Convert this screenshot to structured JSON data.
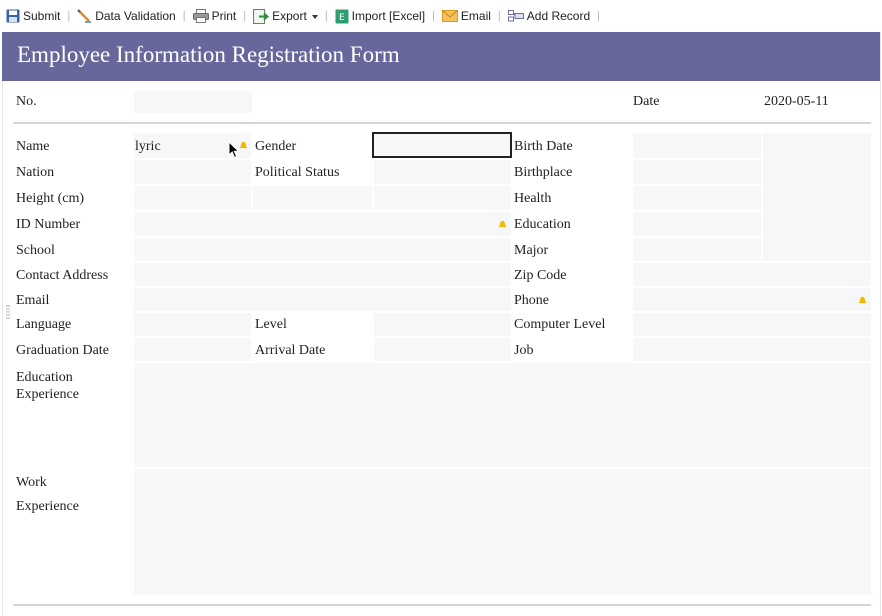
{
  "toolbar": {
    "items": [
      {
        "label": "Submit",
        "icon": "save-icon"
      },
      {
        "label": "Data Validation",
        "icon": "pencil-icon"
      },
      {
        "label": "Print",
        "icon": "printer-icon"
      },
      {
        "label": "Export",
        "icon": "export-icon"
      },
      {
        "label": "Import [Excel]",
        "icon": "excel-icon"
      },
      {
        "label": "Email",
        "icon": "envelope-icon"
      },
      {
        "label": "Add Record",
        "icon": "add-record-icon"
      }
    ]
  },
  "form": {
    "title": "Employee Information Registration Form",
    "header_color": "#67679c",
    "no_label": "No.",
    "date_label": "Date",
    "date_value": "2020-05-11",
    "labels": {
      "name": "Name",
      "gender": "Gender",
      "birth_date": "Birth Date",
      "nation": "Nation",
      "political_status": "Political Status",
      "birthplace": "Birthplace",
      "height": "Height (cm)",
      "health": "Health",
      "id_number": "ID Number",
      "education": "Education",
      "school": "School",
      "major": "Major",
      "contact_address": "Contact Address",
      "zip_code": "Zip Code",
      "email": "Email",
      "phone": "Phone",
      "language": "Language",
      "level": "Level",
      "computer_level": "Computer Level",
      "graduation_date": "Graduation Date",
      "arrival_date": "Arrival Date",
      "job": "Job",
      "education_experience_1": "Education",
      "education_experience_2": "Experience",
      "work_experience_1": "Work",
      "work_experience_2": "Experience"
    },
    "values": {
      "name": "lyric"
    },
    "required_color": "#f5b800"
  }
}
